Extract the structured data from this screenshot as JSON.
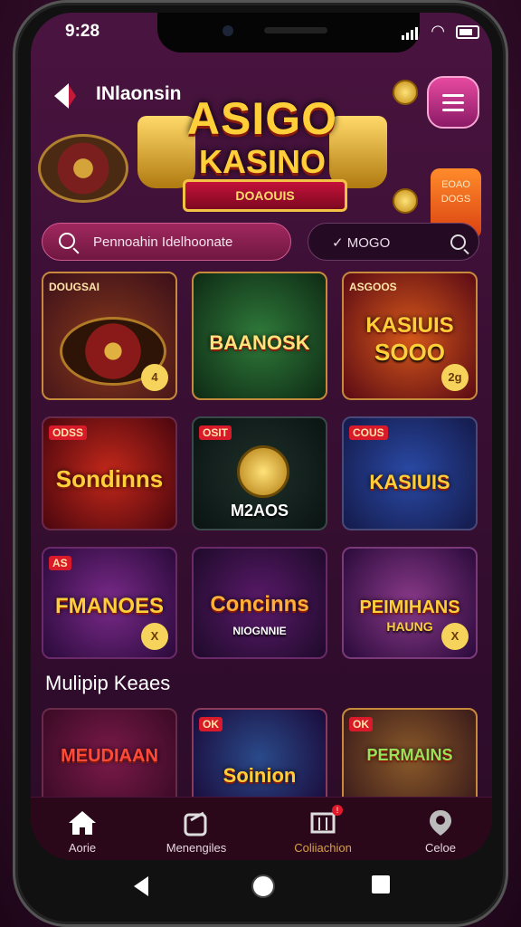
{
  "status": {
    "time": "9:28"
  },
  "header": {
    "brand": "INlaonsin",
    "logo_line1": "ASIGO",
    "logo_line2": "KASINO",
    "logo_ribbon": "DOAOUIS",
    "promo_text": "EOAO DOGS"
  },
  "search": {
    "placeholder": "Pennoahin Idelhoonate"
  },
  "filter": {
    "label": "✓ MOGO"
  },
  "games": [
    {
      "tag": "DOUGSAI",
      "title": "",
      "sub": "",
      "badge": "4"
    },
    {
      "tag": "",
      "title": "BAANOSK",
      "sub": "",
      "badge": ""
    },
    {
      "tag": "ASGOOS",
      "title": "KASIUIS",
      "sub": "SOOO",
      "badge": "2g"
    },
    {
      "tag": "ODSS",
      "title": "Sondinns",
      "sub": "",
      "badge": ""
    },
    {
      "tag": "OSIT",
      "title": "M2AOS",
      "sub": "",
      "badge": ""
    },
    {
      "tag": "COUS",
      "title": "KASIUIS",
      "sub": "",
      "badge": ""
    },
    {
      "tag": "AS",
      "title": "FMANOES",
      "sub": "",
      "badge": "X"
    },
    {
      "tag": "",
      "title": "Concinns",
      "sub": "NIOGNNIE",
      "badge": ""
    },
    {
      "tag": "",
      "title": "PEIMIHANS",
      "sub": "HAUNG",
      "badge": "X"
    }
  ],
  "section_title": "Mulipip Keaes",
  "more_games": [
    {
      "tag": "",
      "title": "MEUDIAAN"
    },
    {
      "tag": "OK",
      "title": "Soinion"
    },
    {
      "tag": "OK",
      "title": "PERMAINS"
    }
  ],
  "nav": {
    "items": [
      {
        "label": "Aorie"
      },
      {
        "label": "Menengiles"
      },
      {
        "label": "Coliiachion",
        "badge": "!"
      },
      {
        "label": "Celoe"
      }
    ]
  },
  "colors": {
    "accent": "#d8a24a",
    "brand_pink": "#e74aa0",
    "gold": "#ffcf3a"
  }
}
